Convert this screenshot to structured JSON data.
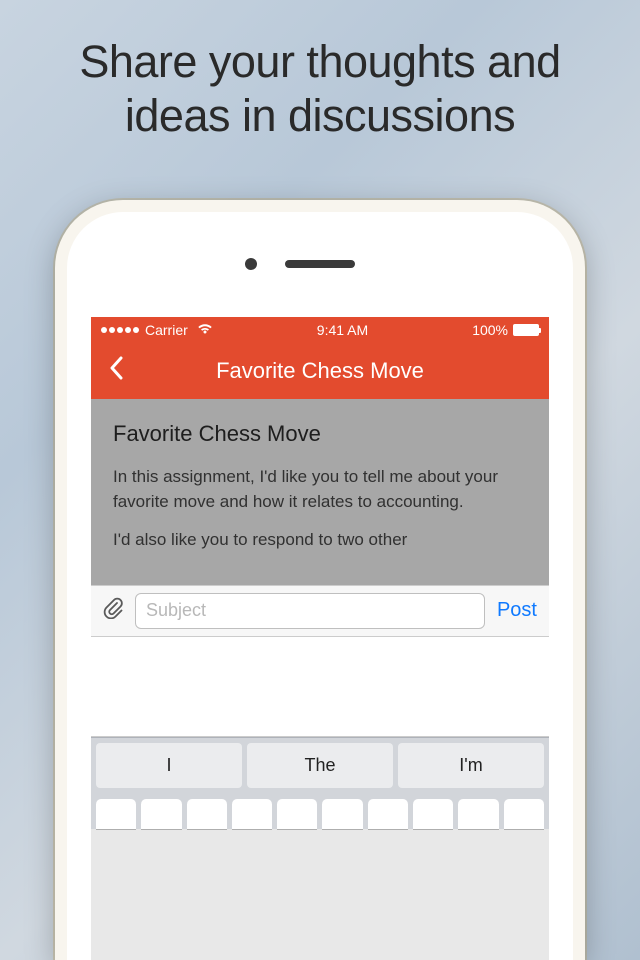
{
  "promo": {
    "line1": "Share your thoughts and",
    "line2": "ideas in discussions"
  },
  "statusBar": {
    "carrier": "Carrier",
    "time": "9:41 AM",
    "battery": "100%"
  },
  "nav": {
    "title": "Favorite Chess Move"
  },
  "thread": {
    "title": "Favorite Chess Move",
    "para1": "In this assignment, I'd like you to tell me about your favorite move and how it relates to accounting.",
    "para2": "I'd also like you to respond to two other"
  },
  "compose": {
    "placeholder": "Subject",
    "postLabel": "Post"
  },
  "suggestions": {
    "s1": "I",
    "s2": "The",
    "s3": "I'm"
  }
}
